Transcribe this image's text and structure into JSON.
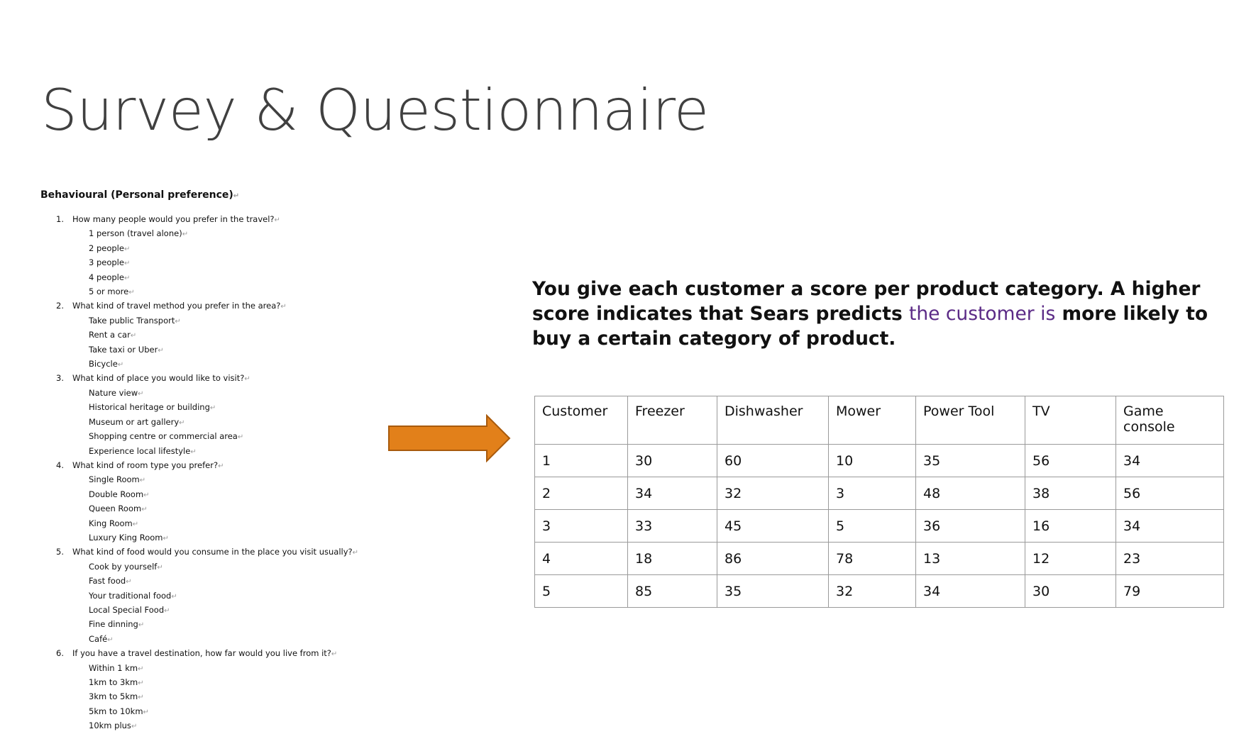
{
  "title": "Survey & Questionnaire",
  "survey": {
    "heading": "Behavioural (Personal preference)",
    "return_mark": "↵",
    "questions": [
      {
        "number": "1.",
        "text": "How many people would you prefer in the travel?",
        "options": [
          "1 person (travel alone)",
          "2 people",
          "3 people",
          "4 people",
          "5 or more"
        ]
      },
      {
        "number": "2.",
        "text": "What kind of travel method you prefer in the area?",
        "options": [
          "Take public Transport",
          "Rent a car",
          "Take taxi or Uber",
          "Bicycle"
        ]
      },
      {
        "number": "3.",
        "text": "What kind of place you would like to visit?",
        "options": [
          "Nature view",
          "Historical heritage or building",
          "Museum or art gallery",
          "Shopping centre or commercial area",
          "Experience local lifestyle"
        ]
      },
      {
        "number": "4.",
        "text": "What kind of room type you prefer?",
        "options": [
          "Single Room",
          "Double Room",
          "Queen Room",
          "King Room",
          "Luxury King Room"
        ]
      },
      {
        "number": "5.",
        "text": "What kind of food would you consume in the place you visit usually?",
        "options": [
          "Cook by yourself",
          "Fast food",
          "Your traditional food",
          "Local Special Food",
          "Fine dinning",
          "Café"
        ]
      },
      {
        "number": "6.",
        "text": "If you have a travel destination, how far would you live from it?",
        "options": [
          "Within 1 km",
          "1km to 3km",
          "3km to 5km",
          "5km to 10km",
          "10km plus"
        ]
      }
    ]
  },
  "arrow_color": "#e2801a",
  "description": {
    "before": "You give each customer a score per product category. A higher score indicates that Sears predicts ",
    "highlight": "the customer is",
    "after": " more likely to buy a certain category of product.",
    "highlight_color": "#5b2a86"
  },
  "table": {
    "headers": [
      "Customer",
      "Freezer",
      "Dishwasher",
      "Mower",
      "Power Tool",
      "TV",
      "Game console"
    ],
    "rows": [
      [
        "1",
        "30",
        "60",
        "10",
        "35",
        "56",
        "34"
      ],
      [
        "2",
        "34",
        "32",
        "3",
        "48",
        "38",
        "56"
      ],
      [
        "3",
        "33",
        "45",
        "5",
        "36",
        "16",
        "34"
      ],
      [
        "4",
        "18",
        "86",
        "78",
        "13",
        "12",
        "23"
      ],
      [
        "5",
        "85",
        "35",
        "32",
        "34",
        "30",
        "79"
      ]
    ]
  }
}
